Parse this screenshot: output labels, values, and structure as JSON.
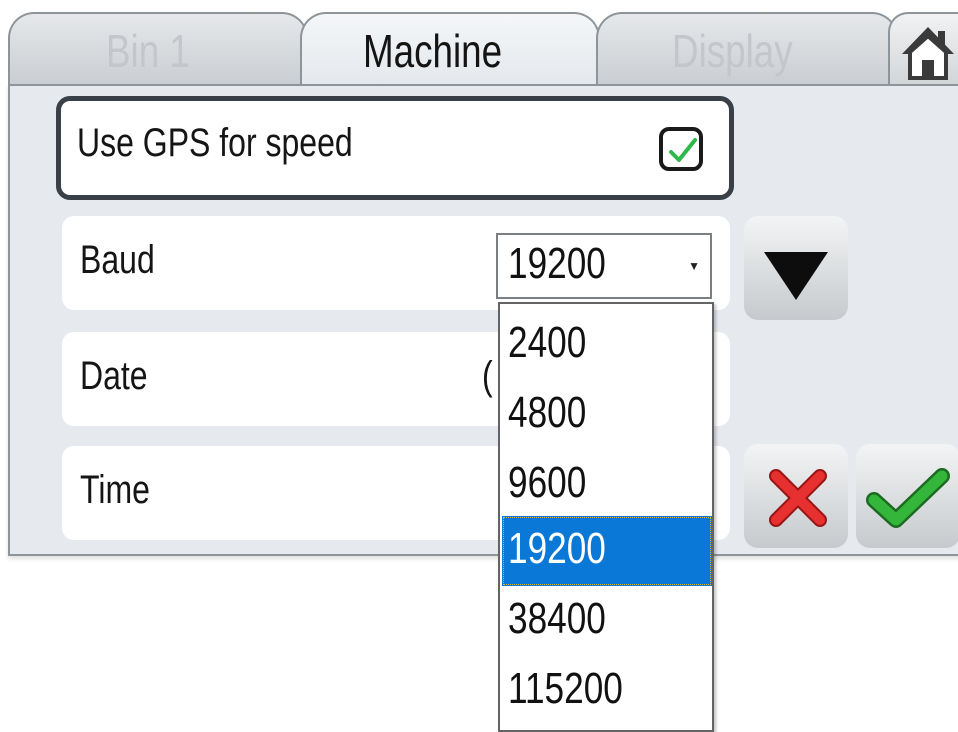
{
  "tabs": [
    {
      "label": "Bin 1"
    },
    {
      "label": "Machine"
    },
    {
      "label": "Display"
    }
  ],
  "rows": {
    "gps": {
      "label": "Use GPS for speed",
      "checked": true
    },
    "baud": {
      "label": "Baud",
      "value": "19200"
    },
    "date": {
      "label": "Date",
      "value_partial": "("
    },
    "time": {
      "label": "Time"
    }
  },
  "dropdown": {
    "options": [
      "2400",
      "4800",
      "9600",
      "19200",
      "38400",
      "115200"
    ],
    "selected": "19200"
  },
  "icons": {
    "home": "home-icon",
    "down": "triangle-down-icon",
    "cancel": "red-x-icon",
    "confirm": "green-check-icon"
  },
  "colors": {
    "selection": "#0a78d7",
    "cancel": "#e02424",
    "confirm": "#2e9a33"
  }
}
